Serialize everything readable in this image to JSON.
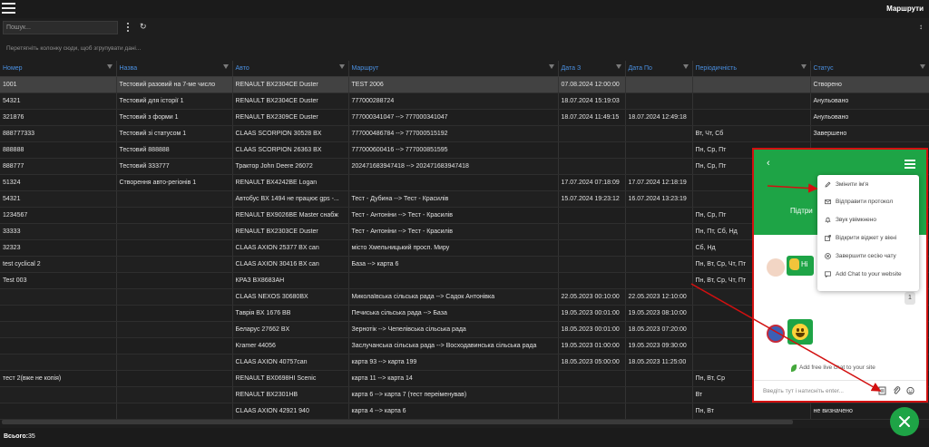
{
  "header": {
    "title": "Маршрути"
  },
  "toolbar": {
    "search_placeholder": "Пошук..."
  },
  "group_panel": {
    "hint": "Перетягніть колонку сюди, щоб згрупувати дані..."
  },
  "table": {
    "columns": [
      "Номер",
      "Назва",
      "Авто",
      "Маршрут",
      "Дата З",
      "Дата По",
      "Періодичність",
      "Статус"
    ],
    "rows": [
      [
        "1001",
        "Тестовий разовий на 7-ме число",
        "RENAULT BX2304CE Duster",
        "TEST 2006",
        "07.08.2024 12:00:00",
        "",
        "",
        "Створено"
      ],
      [
        "54321",
        "Тестовий для історії 1",
        "RENAULT BX2304CE Duster",
        "777000288724",
        "18.07.2024 15:19:03",
        "",
        "",
        "Анульовано"
      ],
      [
        "321876",
        "Тестовий з форми 1",
        "RENAULT BX2309CE Duster",
        "777000341047 --> 777000341047",
        "18.07.2024 11:49:15",
        "18.07.2024 12:49:18",
        "",
        "Анульовано"
      ],
      [
        "888777333",
        "Тестовий зі статусом 1",
        "CLAAS SCORPION 30528 BX",
        "777000486784 --> 777000515192",
        "",
        "",
        "Вт, Чт, Сб",
        "Завершено"
      ],
      [
        "888888",
        "Тестовий 888888",
        "CLAAS SCORPION 26363 BX",
        "777000600416 --> 777000851595",
        "",
        "",
        "Пн, Ср, Пт",
        ""
      ],
      [
        "888777",
        "Тестовий 333777",
        "Трактор John Deere 26072",
        "202471683947418 --> 202471683947418",
        "",
        "",
        "Пн, Ср, Пт",
        ""
      ],
      [
        "51324",
        "Створення авто-регіонів 1",
        "RENAULT BX4242BE Logan",
        "",
        "17.07.2024 07:18:09",
        "17.07.2024 12:18:19",
        "",
        ""
      ],
      [
        "54321",
        "",
        "Автобус BX 1494 не працює gps -...",
        "Тест - Дубина --> Тест - Красилів",
        "15.07.2024 19:23:12",
        "16.07.2024 13:23:19",
        "",
        ""
      ],
      [
        "1234567",
        "",
        "RENAULT BX9026BE Master снабж",
        "Тест - Антоніни --> Тест - Красилів",
        "",
        "",
        "Пн, Ср, Пт",
        ""
      ],
      [
        "33333",
        "",
        "RENAULT BX2303CE Duster",
        "Тест - Антоніни --> Тест - Красилів",
        "",
        "",
        "Пн, Пт, Сб, Нд",
        ""
      ],
      [
        "32323",
        "",
        "CLAAS AXION 25377 BX can",
        "місто Хмельницький просп. Миру",
        "",
        "",
        "Сб, Нд",
        ""
      ],
      [
        "test cyclical 2",
        "",
        "CLAAS AXION 30416 BX can",
        "База --> карта 6",
        "",
        "",
        "Пн, Вт, Ср, Чт, Пт",
        ""
      ],
      [
        "Test 003",
        "",
        "КРАЗ BX8683AH",
        "",
        "",
        "",
        "Пн, Вт, Ср, Чт, Пт",
        ""
      ],
      [
        "",
        "",
        "CLAAS NEXOS 30680BX",
        "Миколаївська сільська рада --> Садок Антонівка",
        "22.05.2023 00:10:00",
        "22.05.2023 12:10:00",
        "",
        ""
      ],
      [
        "",
        "",
        "Таврія BX 1676 BB",
        "Печиська сільська рада --> База",
        "19.05.2023 00:01:00",
        "19.05.2023 08:10:00",
        "",
        ""
      ],
      [
        "",
        "",
        "Беларус 27662 BX",
        "Зернотік --> Чепелівська сільська рада",
        "18.05.2023 00:01:00",
        "18.05.2023 07:20:00",
        "",
        ""
      ],
      [
        "",
        "",
        "Kramer 44056",
        "Заслучанська сільська рада --> Восходавинська сільська рада",
        "19.05.2023 01:00:00",
        "19.05.2023 09:30:00",
        "",
        ""
      ],
      [
        "",
        "",
        "CLAAS AXION 40757can",
        "карта 93 --> карта 199",
        "18.05.2023 05:00:00",
        "18.05.2023 11:25:00",
        "",
        ""
      ],
      [
        "тест 2(вже не копія)",
        "",
        "RENAULT BX0698HI Scenic",
        "карта 11 --> карта 14",
        "",
        "",
        "Пн, Вт, Ср",
        ""
      ],
      [
        "",
        "",
        "RENAULT BX2301HB",
        "карта 6 --> карта 7 (тест переіменував)",
        "",
        "",
        "Вт",
        ""
      ],
      [
        "",
        "",
        "CLAAS AXION 42921 940",
        "карта 4 --> карта 6",
        "",
        "",
        "Пн, Вт",
        "не визначено"
      ]
    ]
  },
  "footer": {
    "total_label": "Всього:",
    "total_value": "35"
  },
  "chat": {
    "title_partial": "Підтри",
    "greeting_partial": "Hi",
    "unread_badge": "1",
    "menu": [
      {
        "label": "Змінити ім'я",
        "icon": "pen-icon"
      },
      {
        "label": "Відправити протокол",
        "icon": "mail-icon"
      },
      {
        "label": "Звук увімкнено",
        "icon": "bell-icon"
      },
      {
        "label": "Відкрити віджет у вікні",
        "icon": "external-link-icon"
      },
      {
        "label": "Завершити сесію чату",
        "icon": "close-circle-icon"
      },
      {
        "label": "Add Chat to your website",
        "icon": "chat-bubble-icon"
      }
    ],
    "powered_by": "Add free live chat to your site",
    "input_placeholder": "Введіть тут і натисніть enter..."
  },
  "colors": {
    "accent_green": "#1ea446",
    "header_blue": "#4a90e2",
    "highlight_red": "#d21010",
    "background": "#1e1e1e"
  }
}
